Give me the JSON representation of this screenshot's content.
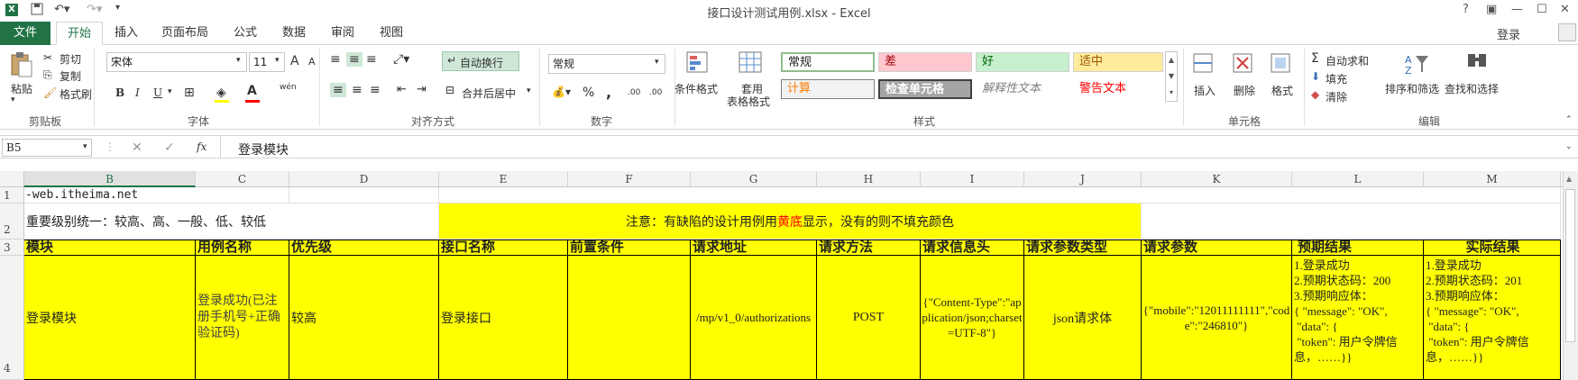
{
  "window": {
    "title": "接口设计测试用例.xlsx - Excel",
    "help": "?",
    "signin": "登录"
  },
  "tabs": [
    "文件",
    "开始",
    "插入",
    "页面布局",
    "公式",
    "数据",
    "审阅",
    "视图"
  ],
  "ribbon": {
    "clipboard": {
      "paste": "粘贴",
      "cut": "剪切",
      "copy": "复制",
      "format_painter": "格式刷",
      "label": "剪贴板"
    },
    "font": {
      "name": "宋体",
      "size": "11",
      "bold": "B",
      "italic": "I",
      "underline": "U",
      "label": "字体",
      "grow": "A",
      "shrink": "A",
      "wen": "wén"
    },
    "alignment": {
      "wrap": "自动换行",
      "merge": "合并后居中",
      "label": "对齐方式"
    },
    "number": {
      "format": "常规",
      "label": "数字",
      "percent": "%",
      "comma": ",",
      "inc": ".00",
      "dec": ".00"
    },
    "styles": {
      "cond": "条件格式",
      "table": "套用",
      "table2": "表格格式",
      "cells": [
        "常规",
        "差",
        "好",
        "适中",
        "计算",
        "检查单元格",
        "解释性文本",
        "警告文本"
      ],
      "label": "样式"
    },
    "cells": {
      "insert": "插入",
      "delete": "删除",
      "format": "格式",
      "label": "单元格"
    },
    "editing": {
      "autosum": "自动求和",
      "fill": "填充",
      "clear": "清除",
      "sort": "排序和筛选",
      "find": "查找和选择",
      "label": "编辑"
    }
  },
  "formula": {
    "namebox": "B5",
    "fx": "fx",
    "content": "登录模块"
  },
  "columns": [
    "B",
    "C",
    "D",
    "E",
    "F",
    "G",
    "H",
    "I",
    "J",
    "K",
    "L",
    "M"
  ],
  "rows": [
    "1",
    "2",
    "3",
    "4"
  ],
  "sheet": {
    "r1_b": "-web.itheima.net",
    "r2_b": "重要级别统一：较高、高、一般、低、较低",
    "r2_note_a": "注意：有缺陷的设计用例用",
    "r2_note_red": "黄底",
    "r2_note_b": "显示，没有的则不填充颜色",
    "headers": [
      "模块",
      "用例名称",
      "优先级",
      "接口名称",
      "前置条件",
      "请求地址",
      "请求方法",
      "请求信息头",
      "请求参数类型",
      "请求参数",
      "预期结果",
      "实际结果"
    ],
    "r4": {
      "module": "登录模块",
      "case_name": "登录成功(已注册手机号+正确验证码)",
      "priority": "较高",
      "api_name": "登录接口",
      "precondition": "",
      "url": "/mp/v1_0/authorizations",
      "method": "POST",
      "headers": "{\"Content-Type\":\"application/json;charset=UTF-8\"}",
      "param_type": "json请求体",
      "params": "{\"mobile\":\"12011111111\",\"code\":\"246810\"}",
      "expected": "1.登录成功\n2.预期状态码：200\n3.预期响应体：\n{ \"message\": \"OK\",\n \"data\": {\n \"token\": 用户令牌信息，……}}",
      "actual": "1.登录成功\n2.预期状态码：201\n3.预期响应体：\n{ \"message\": \"OK\",\n \"data\": {\n \"token\": 用户令牌信息，……}}"
    }
  },
  "colors": {
    "excel_green": "#217346",
    "yellow": "#ffff00",
    "red": "#ff0000"
  }
}
